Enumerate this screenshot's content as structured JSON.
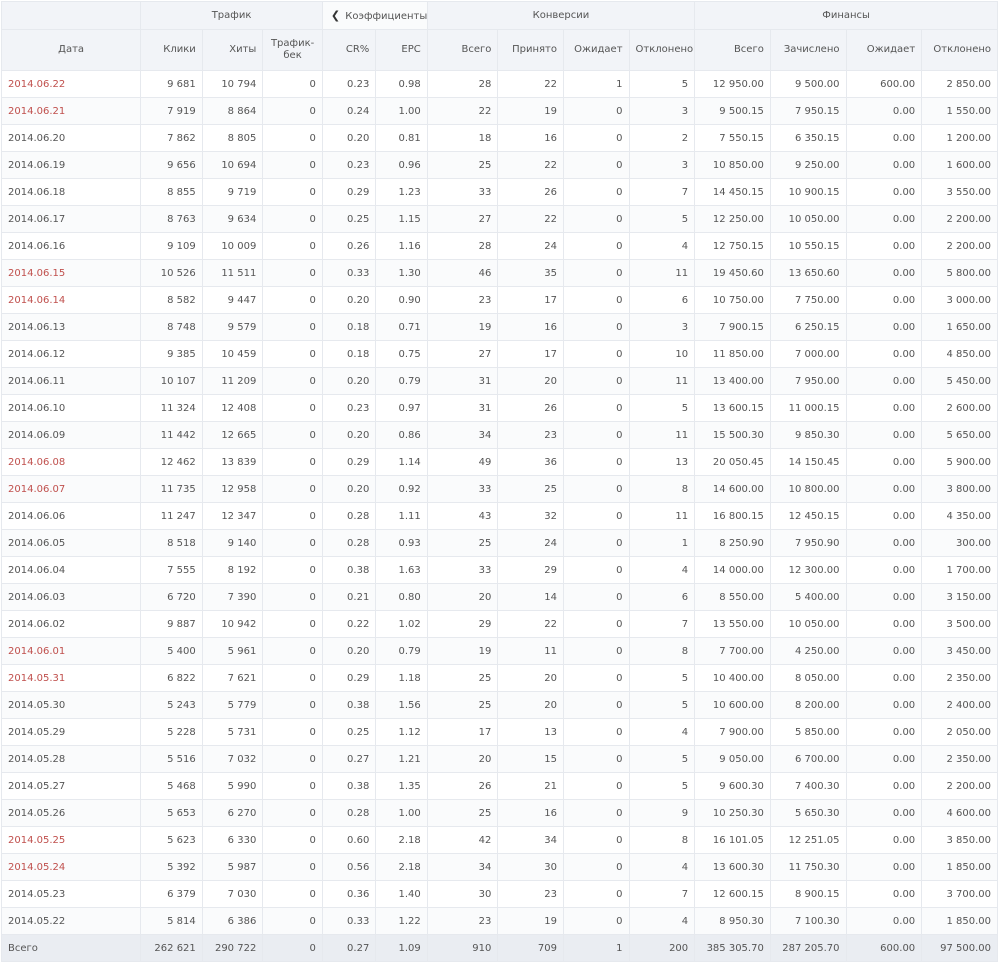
{
  "groups": {
    "traffic": "Трафик",
    "coefficients": "Коэффициенты",
    "conversions": "Конверсии",
    "finances": "Финансы",
    "prev_icon": "chevron-left-icon",
    "next_icon": "chevron-right-icon"
  },
  "columns": {
    "date": "Дата",
    "clicks": "Клики",
    "hits": "Хиты",
    "trafficback_1": "Трафик-",
    "trafficback_2": "бек",
    "cr": "CR%",
    "epc": "EPC",
    "conv_total": "Всего",
    "conv_accepted": "Принято",
    "conv_pending": "Ожидает",
    "conv_rejected": "Отклонено",
    "fin_total": "Всего",
    "fin_credited": "Зачислено",
    "fin_pending": "Ожидает",
    "fin_rejected": "Отклонено"
  },
  "highlight_color": "#c0504d",
  "rows": [
    {
      "date": "2014.06.22",
      "highlight": true,
      "clicks": "9 681",
      "hits": "10 794",
      "tb": "0",
      "cr": "0.23",
      "epc": "0.98",
      "ct": "28",
      "ca": "22",
      "cp": "1",
      "cr2": "5",
      "ft": "12 950.00",
      "fc": "9 500.00",
      "fp": "600.00",
      "fr": "2 850.00"
    },
    {
      "date": "2014.06.21",
      "highlight": true,
      "clicks": "7 919",
      "hits": "8 864",
      "tb": "0",
      "cr": "0.24",
      "epc": "1.00",
      "ct": "22",
      "ca": "19",
      "cp": "0",
      "cr2": "3",
      "ft": "9 500.15",
      "fc": "7 950.15",
      "fp": "0.00",
      "fr": "1 550.00"
    },
    {
      "date": "2014.06.20",
      "highlight": false,
      "clicks": "7 862",
      "hits": "8 805",
      "tb": "0",
      "cr": "0.20",
      "epc": "0.81",
      "ct": "18",
      "ca": "16",
      "cp": "0",
      "cr2": "2",
      "ft": "7 550.15",
      "fc": "6 350.15",
      "fp": "0.00",
      "fr": "1 200.00"
    },
    {
      "date": "2014.06.19",
      "highlight": false,
      "clicks": "9 656",
      "hits": "10 694",
      "tb": "0",
      "cr": "0.23",
      "epc": "0.96",
      "ct": "25",
      "ca": "22",
      "cp": "0",
      "cr2": "3",
      "ft": "10 850.00",
      "fc": "9 250.00",
      "fp": "0.00",
      "fr": "1 600.00"
    },
    {
      "date": "2014.06.18",
      "highlight": false,
      "clicks": "8 855",
      "hits": "9 719",
      "tb": "0",
      "cr": "0.29",
      "epc": "1.23",
      "ct": "33",
      "ca": "26",
      "cp": "0",
      "cr2": "7",
      "ft": "14 450.15",
      "fc": "10 900.15",
      "fp": "0.00",
      "fr": "3 550.00"
    },
    {
      "date": "2014.06.17",
      "highlight": false,
      "clicks": "8 763",
      "hits": "9 634",
      "tb": "0",
      "cr": "0.25",
      "epc": "1.15",
      "ct": "27",
      "ca": "22",
      "cp": "0",
      "cr2": "5",
      "ft": "12 250.00",
      "fc": "10 050.00",
      "fp": "0.00",
      "fr": "2 200.00"
    },
    {
      "date": "2014.06.16",
      "highlight": false,
      "clicks": "9 109",
      "hits": "10 009",
      "tb": "0",
      "cr": "0.26",
      "epc": "1.16",
      "ct": "28",
      "ca": "24",
      "cp": "0",
      "cr2": "4",
      "ft": "12 750.15",
      "fc": "10 550.15",
      "fp": "0.00",
      "fr": "2 200.00"
    },
    {
      "date": "2014.06.15",
      "highlight": true,
      "clicks": "10 526",
      "hits": "11 511",
      "tb": "0",
      "cr": "0.33",
      "epc": "1.30",
      "ct": "46",
      "ca": "35",
      "cp": "0",
      "cr2": "11",
      "ft": "19 450.60",
      "fc": "13 650.60",
      "fp": "0.00",
      "fr": "5 800.00"
    },
    {
      "date": "2014.06.14",
      "highlight": true,
      "clicks": "8 582",
      "hits": "9 447",
      "tb": "0",
      "cr": "0.20",
      "epc": "0.90",
      "ct": "23",
      "ca": "17",
      "cp": "0",
      "cr2": "6",
      "ft": "10 750.00",
      "fc": "7 750.00",
      "fp": "0.00",
      "fr": "3 000.00"
    },
    {
      "date": "2014.06.13",
      "highlight": false,
      "clicks": "8 748",
      "hits": "9 579",
      "tb": "0",
      "cr": "0.18",
      "epc": "0.71",
      "ct": "19",
      "ca": "16",
      "cp": "0",
      "cr2": "3",
      "ft": "7 900.15",
      "fc": "6 250.15",
      "fp": "0.00",
      "fr": "1 650.00"
    },
    {
      "date": "2014.06.12",
      "highlight": false,
      "clicks": "9 385",
      "hits": "10 459",
      "tb": "0",
      "cr": "0.18",
      "epc": "0.75",
      "ct": "27",
      "ca": "17",
      "cp": "0",
      "cr2": "10",
      "ft": "11 850.00",
      "fc": "7 000.00",
      "fp": "0.00",
      "fr": "4 850.00"
    },
    {
      "date": "2014.06.11",
      "highlight": false,
      "clicks": "10 107",
      "hits": "11 209",
      "tb": "0",
      "cr": "0.20",
      "epc": "0.79",
      "ct": "31",
      "ca": "20",
      "cp": "0",
      "cr2": "11",
      "ft": "13 400.00",
      "fc": "7 950.00",
      "fp": "0.00",
      "fr": "5 450.00"
    },
    {
      "date": "2014.06.10",
      "highlight": false,
      "clicks": "11 324",
      "hits": "12 408",
      "tb": "0",
      "cr": "0.23",
      "epc": "0.97",
      "ct": "31",
      "ca": "26",
      "cp": "0",
      "cr2": "5",
      "ft": "13 600.15",
      "fc": "11 000.15",
      "fp": "0.00",
      "fr": "2 600.00"
    },
    {
      "date": "2014.06.09",
      "highlight": false,
      "clicks": "11 442",
      "hits": "12 665",
      "tb": "0",
      "cr": "0.20",
      "epc": "0.86",
      "ct": "34",
      "ca": "23",
      "cp": "0",
      "cr2": "11",
      "ft": "15 500.30",
      "fc": "9 850.30",
      "fp": "0.00",
      "fr": "5 650.00"
    },
    {
      "date": "2014.06.08",
      "highlight": true,
      "clicks": "12 462",
      "hits": "13 839",
      "tb": "0",
      "cr": "0.29",
      "epc": "1.14",
      "ct": "49",
      "ca": "36",
      "cp": "0",
      "cr2": "13",
      "ft": "20 050.45",
      "fc": "14 150.45",
      "fp": "0.00",
      "fr": "5 900.00"
    },
    {
      "date": "2014.06.07",
      "highlight": true,
      "clicks": "11 735",
      "hits": "12 958",
      "tb": "0",
      "cr": "0.20",
      "epc": "0.92",
      "ct": "33",
      "ca": "25",
      "cp": "0",
      "cr2": "8",
      "ft": "14 600.00",
      "fc": "10 800.00",
      "fp": "0.00",
      "fr": "3 800.00"
    },
    {
      "date": "2014.06.06",
      "highlight": false,
      "clicks": "11 247",
      "hits": "12 347",
      "tb": "0",
      "cr": "0.28",
      "epc": "1.11",
      "ct": "43",
      "ca": "32",
      "cp": "0",
      "cr2": "11",
      "ft": "16 800.15",
      "fc": "12 450.15",
      "fp": "0.00",
      "fr": "4 350.00"
    },
    {
      "date": "2014.06.05",
      "highlight": false,
      "clicks": "8 518",
      "hits": "9 140",
      "tb": "0",
      "cr": "0.28",
      "epc": "0.93",
      "ct": "25",
      "ca": "24",
      "cp": "0",
      "cr2": "1",
      "ft": "8 250.90",
      "fc": "7 950.90",
      "fp": "0.00",
      "fr": "300.00"
    },
    {
      "date": "2014.06.04",
      "highlight": false,
      "clicks": "7 555",
      "hits": "8 192",
      "tb": "0",
      "cr": "0.38",
      "epc": "1.63",
      "ct": "33",
      "ca": "29",
      "cp": "0",
      "cr2": "4",
      "ft": "14 000.00",
      "fc": "12 300.00",
      "fp": "0.00",
      "fr": "1 700.00"
    },
    {
      "date": "2014.06.03",
      "highlight": false,
      "clicks": "6 720",
      "hits": "7 390",
      "tb": "0",
      "cr": "0.21",
      "epc": "0.80",
      "ct": "20",
      "ca": "14",
      "cp": "0",
      "cr2": "6",
      "ft": "8 550.00",
      "fc": "5 400.00",
      "fp": "0.00",
      "fr": "3 150.00"
    },
    {
      "date": "2014.06.02",
      "highlight": false,
      "clicks": "9 887",
      "hits": "10 942",
      "tb": "0",
      "cr": "0.22",
      "epc": "1.02",
      "ct": "29",
      "ca": "22",
      "cp": "0",
      "cr2": "7",
      "ft": "13 550.00",
      "fc": "10 050.00",
      "fp": "0.00",
      "fr": "3 500.00"
    },
    {
      "date": "2014.06.01",
      "highlight": true,
      "clicks": "5 400",
      "hits": "5 961",
      "tb": "0",
      "cr": "0.20",
      "epc": "0.79",
      "ct": "19",
      "ca": "11",
      "cp": "0",
      "cr2": "8",
      "ft": "7 700.00",
      "fc": "4 250.00",
      "fp": "0.00",
      "fr": "3 450.00"
    },
    {
      "date": "2014.05.31",
      "highlight": true,
      "clicks": "6 822",
      "hits": "7 621",
      "tb": "0",
      "cr": "0.29",
      "epc": "1.18",
      "ct": "25",
      "ca": "20",
      "cp": "0",
      "cr2": "5",
      "ft": "10 400.00",
      "fc": "8 050.00",
      "fp": "0.00",
      "fr": "2 350.00"
    },
    {
      "date": "2014.05.30",
      "highlight": false,
      "clicks": "5 243",
      "hits": "5 779",
      "tb": "0",
      "cr": "0.38",
      "epc": "1.56",
      "ct": "25",
      "ca": "20",
      "cp": "0",
      "cr2": "5",
      "ft": "10 600.00",
      "fc": "8 200.00",
      "fp": "0.00",
      "fr": "2 400.00"
    },
    {
      "date": "2014.05.29",
      "highlight": false,
      "clicks": "5 228",
      "hits": "5 731",
      "tb": "0",
      "cr": "0.25",
      "epc": "1.12",
      "ct": "17",
      "ca": "13",
      "cp": "0",
      "cr2": "4",
      "ft": "7 900.00",
      "fc": "5 850.00",
      "fp": "0.00",
      "fr": "2 050.00"
    },
    {
      "date": "2014.05.28",
      "highlight": false,
      "clicks": "5 516",
      "hits": "7 032",
      "tb": "0",
      "cr": "0.27",
      "epc": "1.21",
      "ct": "20",
      "ca": "15",
      "cp": "0",
      "cr2": "5",
      "ft": "9 050.00",
      "fc": "6 700.00",
      "fp": "0.00",
      "fr": "2 350.00"
    },
    {
      "date": "2014.05.27",
      "highlight": false,
      "clicks": "5 468",
      "hits": "5 990",
      "tb": "0",
      "cr": "0.38",
      "epc": "1.35",
      "ct": "26",
      "ca": "21",
      "cp": "0",
      "cr2": "5",
      "ft": "9 600.30",
      "fc": "7 400.30",
      "fp": "0.00",
      "fr": "2 200.00"
    },
    {
      "date": "2014.05.26",
      "highlight": false,
      "clicks": "5 653",
      "hits": "6 270",
      "tb": "0",
      "cr": "0.28",
      "epc": "1.00",
      "ct": "25",
      "ca": "16",
      "cp": "0",
      "cr2": "9",
      "ft": "10 250.30",
      "fc": "5 650.30",
      "fp": "0.00",
      "fr": "4 600.00"
    },
    {
      "date": "2014.05.25",
      "highlight": true,
      "clicks": "5 623",
      "hits": "6 330",
      "tb": "0",
      "cr": "0.60",
      "epc": "2.18",
      "ct": "42",
      "ca": "34",
      "cp": "0",
      "cr2": "8",
      "ft": "16 101.05",
      "fc": "12 251.05",
      "fp": "0.00",
      "fr": "3 850.00"
    },
    {
      "date": "2014.05.24",
      "highlight": true,
      "clicks": "5 392",
      "hits": "5 987",
      "tb": "0",
      "cr": "0.56",
      "epc": "2.18",
      "ct": "34",
      "ca": "30",
      "cp": "0",
      "cr2": "4",
      "ft": "13 600.30",
      "fc": "11 750.30",
      "fp": "0.00",
      "fr": "1 850.00"
    },
    {
      "date": "2014.05.23",
      "highlight": false,
      "clicks": "6 379",
      "hits": "7 030",
      "tb": "0",
      "cr": "0.36",
      "epc": "1.40",
      "ct": "30",
      "ca": "23",
      "cp": "0",
      "cr2": "7",
      "ft": "12 600.15",
      "fc": "8 900.15",
      "fp": "0.00",
      "fr": "3 700.00"
    },
    {
      "date": "2014.05.22",
      "highlight": false,
      "clicks": "5 814",
      "hits": "6 386",
      "tb": "0",
      "cr": "0.33",
      "epc": "1.22",
      "ct": "23",
      "ca": "19",
      "cp": "0",
      "cr2": "4",
      "ft": "8 950.30",
      "fc": "7 100.30",
      "fp": "0.00",
      "fr": "1 850.00"
    }
  ],
  "totals": {
    "label": "Всего",
    "clicks": "262 621",
    "hits": "290 722",
    "tb": "0",
    "cr": "0.27",
    "epc": "1.09",
    "ct": "910",
    "ca": "709",
    "cp": "1",
    "cr2": "200",
    "ft": "385 305.70",
    "fc": "287 205.70",
    "fp": "600.00",
    "fr": "97 500.00"
  }
}
